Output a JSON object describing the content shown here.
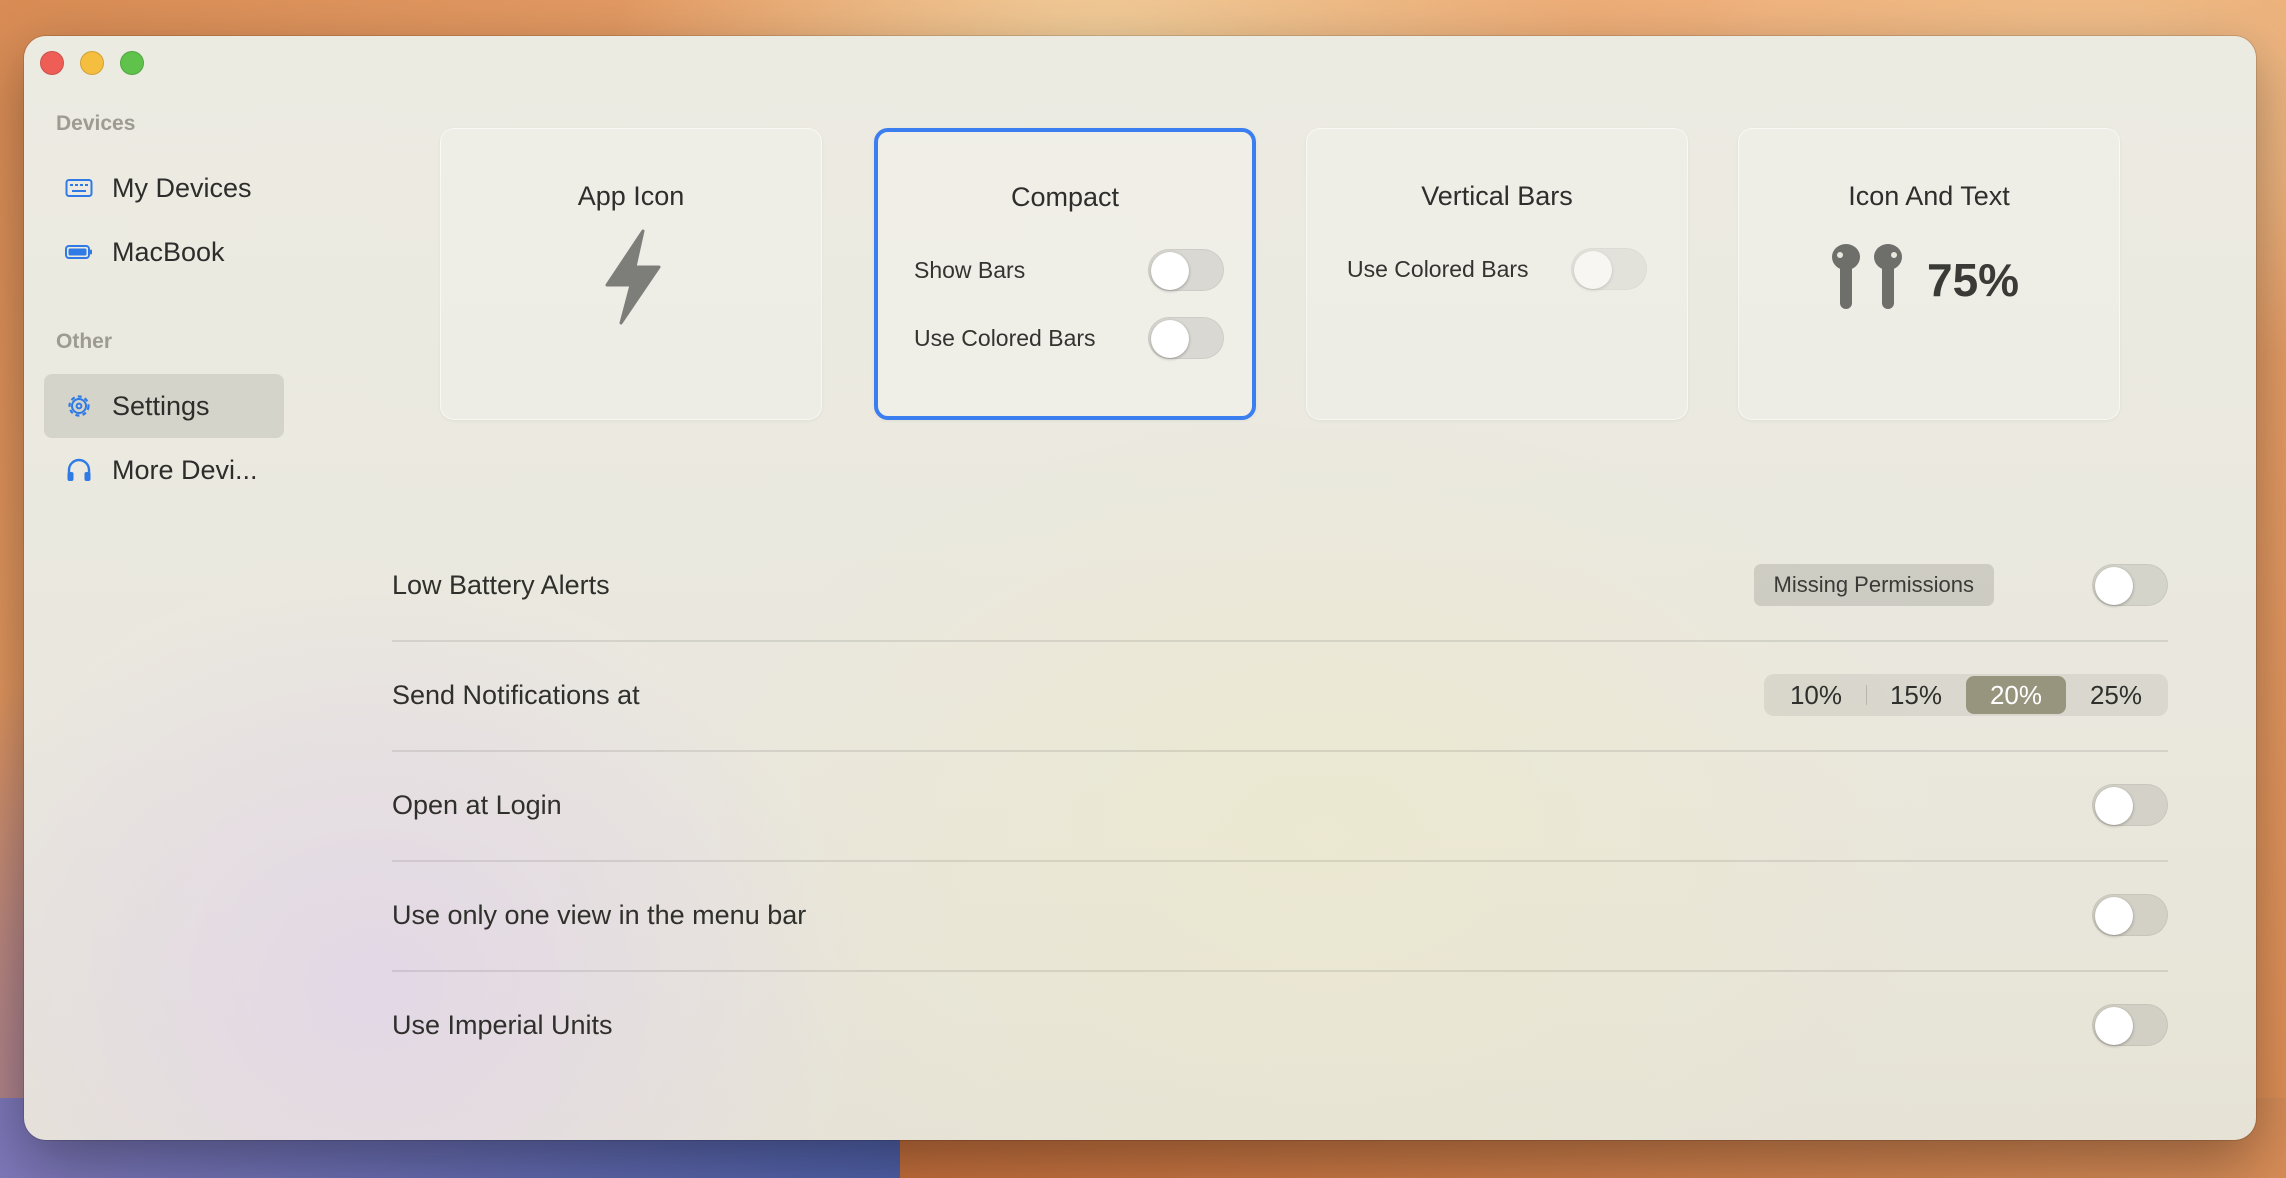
{
  "sidebar": {
    "sections": [
      {
        "title": "Devices",
        "items": [
          {
            "label": "My Devices",
            "icon": "keyboard-icon"
          },
          {
            "label": "MacBook",
            "icon": "battery-icon"
          }
        ]
      },
      {
        "title": "Other",
        "items": [
          {
            "label": "Settings",
            "icon": "gear-icon",
            "selected": true
          },
          {
            "label": "More Devi...",
            "icon": "headphones-icon"
          }
        ]
      }
    ]
  },
  "styles": {
    "selected_style": "Compact",
    "cards": [
      {
        "title": "App Icon",
        "icon": "lightning-bolt-icon"
      },
      {
        "title": "Compact",
        "options": [
          {
            "label": "Show Bars",
            "on": false
          },
          {
            "label": "Use Colored Bars",
            "on": false
          }
        ]
      },
      {
        "title": "Vertical Bars",
        "options": [
          {
            "label": "Use Colored Bars",
            "on": false,
            "disabled": true
          }
        ]
      },
      {
        "title": "Icon And Text",
        "icon": "airpods-icon",
        "value": "75%"
      }
    ]
  },
  "settings": {
    "low_battery_alerts": {
      "label": "Low Battery Alerts",
      "badge": "Missing Permissions",
      "on": false
    },
    "send_notifications": {
      "label": "Send Notifications at",
      "options": [
        "10%",
        "15%",
        "20%",
        "25%"
      ],
      "selected": "20%"
    },
    "open_at_login": {
      "label": "Open at Login",
      "on": false
    },
    "one_view": {
      "label": "Use only one view in the menu bar",
      "on": false
    },
    "imperial_units": {
      "label": "Use Imperial Units",
      "on": false
    }
  },
  "colors": {
    "accent": "#3a7ef0",
    "sidebar_icon": "#2f7ae5",
    "segment_selected": "#98957f"
  }
}
